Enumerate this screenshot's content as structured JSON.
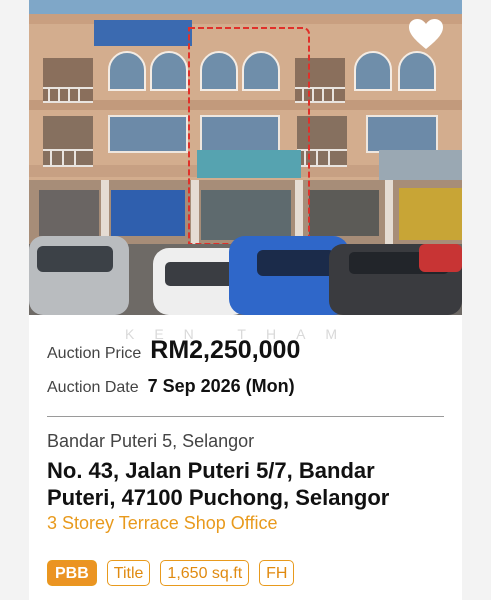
{
  "listing": {
    "watermark": "KEN THAM",
    "auction_price_label": "Auction Price",
    "auction_price": "RM2,250,000",
    "auction_date_label": "Auction Date",
    "auction_date": "7 Sep 2026 (Mon)",
    "area": "Bandar Puteri 5, Selangor",
    "address": "No. 43, Jalan Puteri 5/7, Bandar Puteri, 47100 Puchong, Selangor",
    "property_type": "3 Storey Terrace Shop Office",
    "tags": [
      "PBB",
      "Title",
      "1,650 sq.ft",
      "FH"
    ],
    "favorite_icon": "heart-icon"
  },
  "colors": {
    "accent": "#e89a1d",
    "accent_fill": "#eb9422",
    "highlight_outline": "#e0302a"
  }
}
